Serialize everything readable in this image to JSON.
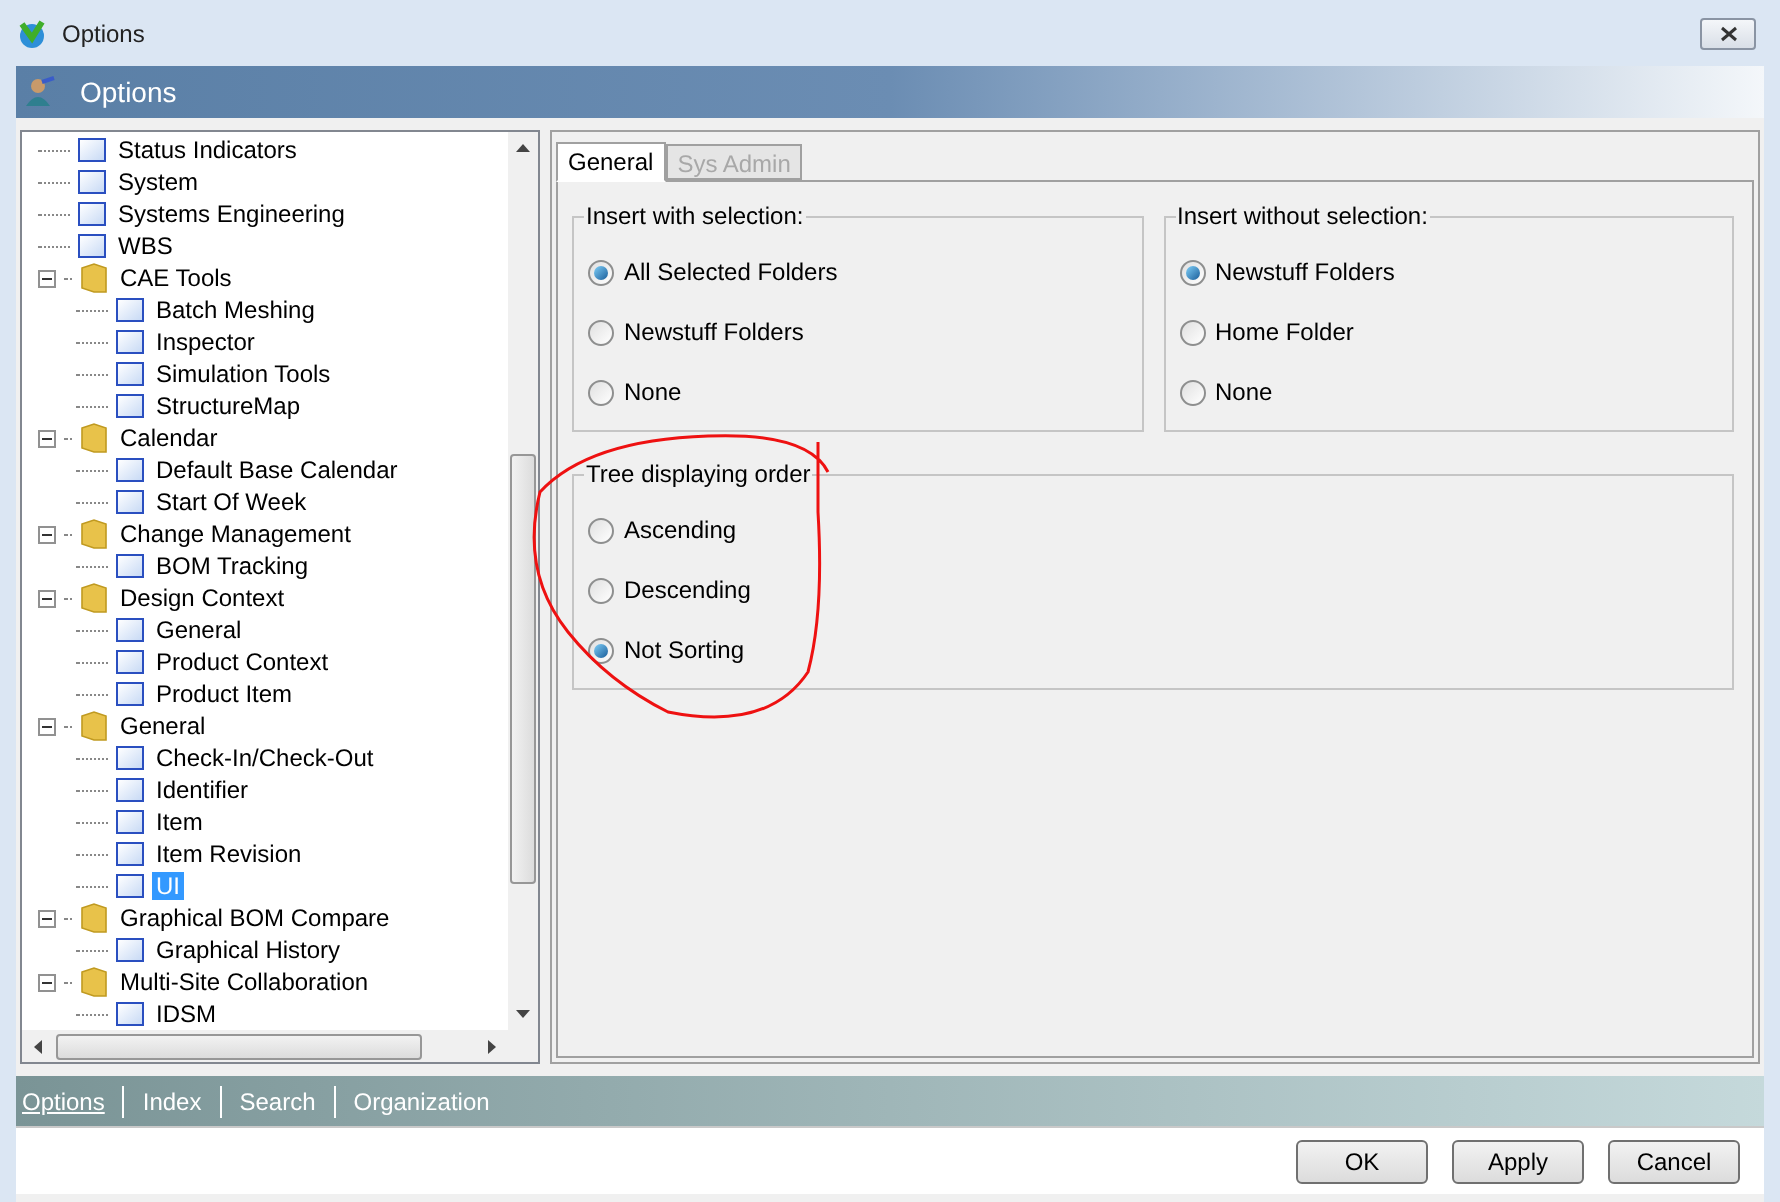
{
  "window": {
    "title": "Options"
  },
  "header": {
    "title": "Options"
  },
  "tree": [
    {
      "label": "Status Indicators",
      "kind": "page",
      "selected": false
    },
    {
      "label": "System",
      "kind": "page",
      "selected": false
    },
    {
      "label": "Systems Engineering",
      "kind": "page",
      "selected": false
    },
    {
      "label": "WBS",
      "kind": "page",
      "selected": false
    },
    {
      "label": "CAE Tools",
      "kind": "folder",
      "expanded": true,
      "children": [
        {
          "label": "Batch Meshing",
          "kind": "page",
          "selected": false
        },
        {
          "label": "Inspector",
          "kind": "page",
          "selected": false
        },
        {
          "label": "Simulation Tools",
          "kind": "page",
          "selected": false
        },
        {
          "label": "StructureMap",
          "kind": "page",
          "selected": false
        }
      ]
    },
    {
      "label": "Calendar",
      "kind": "folder",
      "expanded": true,
      "children": [
        {
          "label": "Default Base Calendar",
          "kind": "page",
          "selected": false
        },
        {
          "label": "Start Of Week",
          "kind": "page",
          "selected": false
        }
      ]
    },
    {
      "label": "Change Management",
      "kind": "folder",
      "expanded": true,
      "children": [
        {
          "label": "BOM Tracking",
          "kind": "page",
          "selected": false
        }
      ]
    },
    {
      "label": "Design Context",
      "kind": "folder",
      "expanded": true,
      "children": [
        {
          "label": "General",
          "kind": "page",
          "selected": false
        },
        {
          "label": "Product Context",
          "kind": "page",
          "selected": false
        },
        {
          "label": "Product Item",
          "kind": "page",
          "selected": false
        }
      ]
    },
    {
      "label": "General",
      "kind": "folder",
      "expanded": true,
      "children": [
        {
          "label": "Check-In/Check-Out",
          "kind": "page",
          "selected": false
        },
        {
          "label": "Identifier",
          "kind": "page",
          "selected": false
        },
        {
          "label": "Item",
          "kind": "page",
          "selected": false
        },
        {
          "label": "Item Revision",
          "kind": "page",
          "selected": false
        },
        {
          "label": "UI",
          "kind": "page",
          "selected": true
        }
      ]
    },
    {
      "label": "Graphical BOM Compare",
      "kind": "folder",
      "expanded": true,
      "children": [
        {
          "label": "Graphical History",
          "kind": "page",
          "selected": false
        }
      ]
    },
    {
      "label": "Multi-Site Collaboration",
      "kind": "folder",
      "expanded": true,
      "children": [
        {
          "label": "IDSM",
          "kind": "page",
          "selected": false
        }
      ]
    }
  ],
  "tabs": [
    {
      "label": "General",
      "selected": true,
      "disabled": false
    },
    {
      "label": "Sys Admin",
      "selected": false,
      "disabled": true
    }
  ],
  "groups": [
    {
      "title": "Insert with selection:",
      "options": [
        {
          "label": "All Selected Folders",
          "selected": true
        },
        {
          "label": "Newstuff Folders",
          "selected": false
        },
        {
          "label": "None",
          "selected": false
        }
      ]
    },
    {
      "title": "Insert without selection:",
      "options": [
        {
          "label": "Newstuff Folders",
          "selected": true
        },
        {
          "label": "Home Folder",
          "selected": false
        },
        {
          "label": "None",
          "selected": false
        }
      ]
    },
    {
      "title": "Tree displaying order",
      "options": [
        {
          "label": "Ascending",
          "selected": false
        },
        {
          "label": "Descending",
          "selected": false
        },
        {
          "label": "Not Sorting",
          "selected": true
        }
      ]
    }
  ],
  "nav": [
    {
      "label": "Options",
      "selected": true
    },
    {
      "label": "Index",
      "selected": false
    },
    {
      "label": "Search",
      "selected": false
    },
    {
      "label": "Organization",
      "selected": false
    }
  ],
  "buttons": [
    "OK",
    "Apply",
    "Cancel"
  ]
}
